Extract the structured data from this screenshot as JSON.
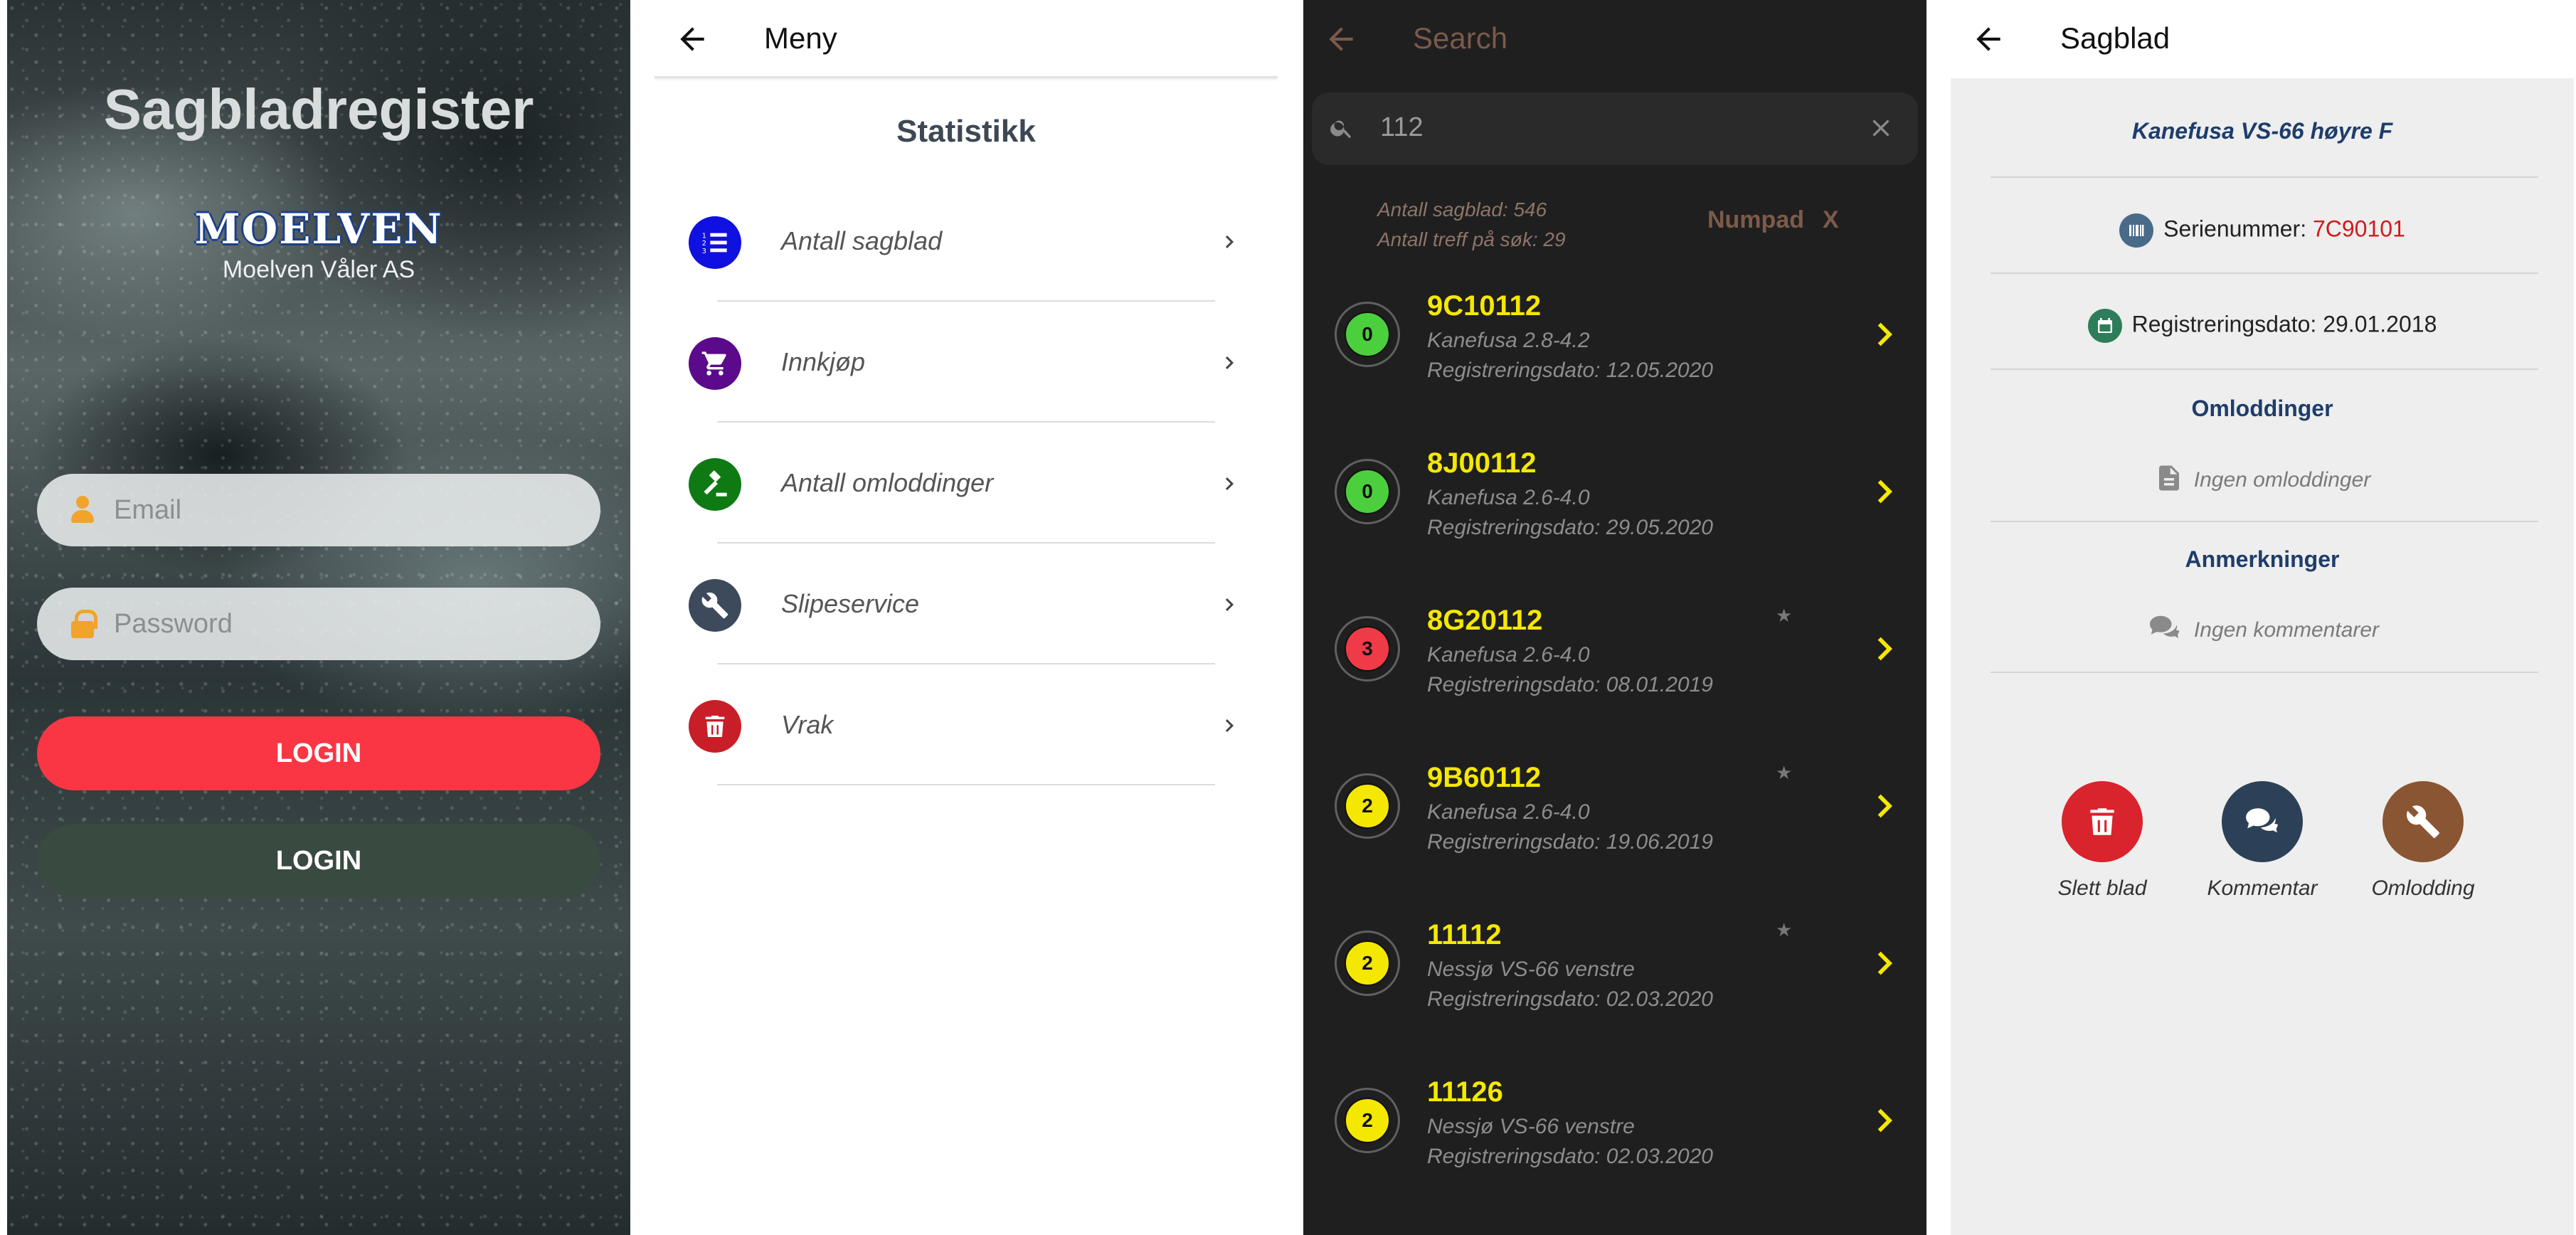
{
  "login": {
    "title": "Sagbladregister",
    "logo": "MOELVEN",
    "company": "Moelven Våler AS",
    "email_placeholder": "Email",
    "password_placeholder": "Password",
    "login_primary": "LOGIN",
    "login_secondary": "LOGIN",
    "colors": {
      "primary": "#fb3644",
      "secondary": "#394a40",
      "field_icon": "#f1a32c"
    }
  },
  "menu": {
    "header_title": "Meny",
    "section_title": "Statistikk",
    "items": [
      {
        "label": "Antall sagblad",
        "icon": "list-numbered-icon",
        "color": "#1010e0"
      },
      {
        "label": "Innkjøp",
        "icon": "cart-icon",
        "color": "#5a0a8a"
      },
      {
        "label": "Antall omloddinger",
        "icon": "gavel-icon",
        "color": "#0f7a14"
      },
      {
        "label": "Slipeservice",
        "icon": "wrench-icon",
        "color": "#3d4a5c"
      },
      {
        "label": "Vrak",
        "icon": "trash-icon",
        "color": "#c81e28"
      }
    ]
  },
  "search": {
    "header_title": "Search",
    "query": "112",
    "stats_total": "Antall sagblad: 546",
    "stats_hits": "Antall treff på søk: 29",
    "numpad_label": "Numpad",
    "close_label": "X",
    "results": [
      {
        "id": "9C10112",
        "model": "Kanefusa 2.8-4.2",
        "date": "Registreringsdato: 12.05.2020",
        "count": "0",
        "badge_color": "#4ccf3c",
        "star": ""
      },
      {
        "id": "8J00112",
        "model": "Kanefusa 2.6-4.0",
        "date": "Registreringsdato: 29.05.2020",
        "count": "0",
        "badge_color": "#4ccf3c",
        "star": ""
      },
      {
        "id": "8G20112",
        "model": "Kanefusa 2.6-4.0",
        "date": "Registreringsdato: 08.01.2019",
        "count": "3",
        "badge_color": "#f03a48",
        "star": "★"
      },
      {
        "id": "9B60112",
        "model": "Kanefusa 2.6-4.0",
        "date": "Registreringsdato: 19.06.2019",
        "count": "2",
        "badge_color": "#f5e800",
        "star": "★"
      },
      {
        "id": "11112",
        "model": "Nessjø VS-66 venstre",
        "date": "Registreringsdato: 02.03.2020",
        "count": "2",
        "badge_color": "#f5e800",
        "star": "★"
      },
      {
        "id": "11126",
        "model": "Nessjø VS-66 venstre",
        "date": "Registreringsdato: 02.03.2020",
        "count": "2",
        "badge_color": "#f5e800",
        "star": ""
      }
    ]
  },
  "detail": {
    "header_title": "Sagblad",
    "blade_name": "Kanefusa VS-66 høyre F",
    "serial_label": "Serienummer: ",
    "serial_value": "7C90101",
    "regdate": "Registreringsdato: 29.01.2018",
    "omloddinger_title": "Omloddinger",
    "omloddinger_empty": "Ingen omloddinger",
    "anmerkninger_title": "Anmerkninger",
    "anmerkninger_empty": "Ingen kommentarer",
    "actions": [
      {
        "label": "Slett blad",
        "icon": "trash-icon",
        "color": "#d9232d"
      },
      {
        "label": "Kommentar",
        "icon": "comments-icon",
        "color": "#2c4157"
      },
      {
        "label": "Omlodding",
        "icon": "wrench-icon",
        "color": "#8a5532"
      }
    ]
  }
}
